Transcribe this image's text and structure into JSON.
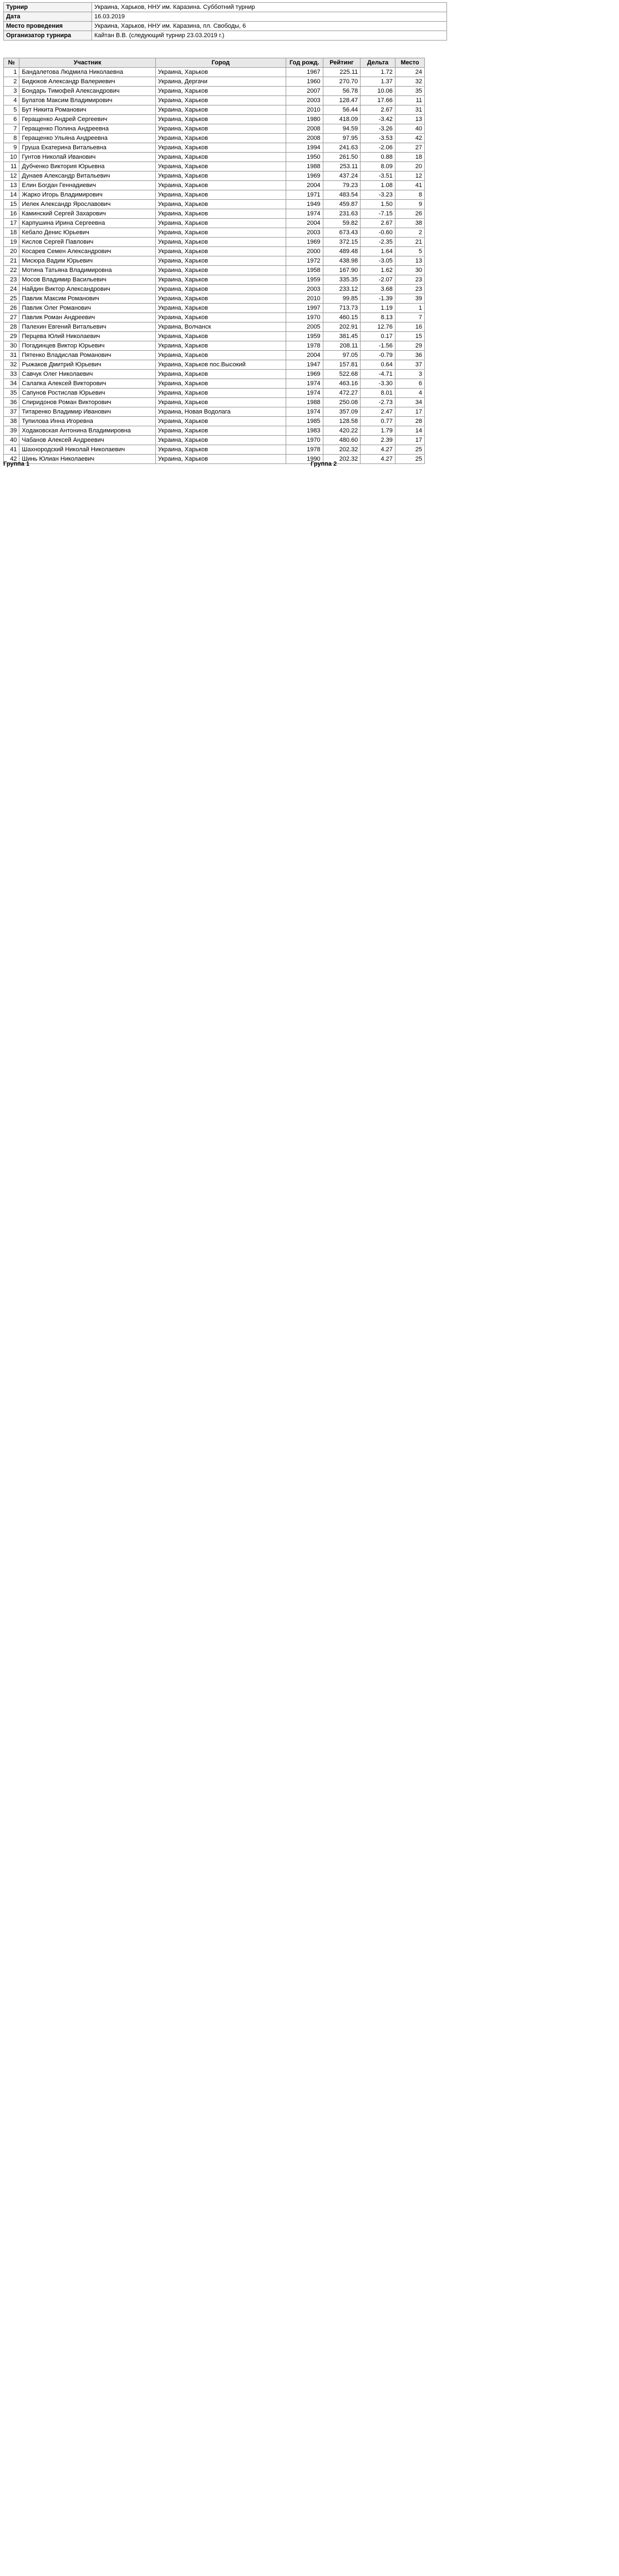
{
  "info": [
    {
      "label": "Турнир",
      "value": "Украина, Харьков, ННУ им. Каразина. Субботний турнир"
    },
    {
      "label": "Дата",
      "value": "16.03.2019"
    },
    {
      "label": "Место проведения",
      "value": "Украина, Харьков, ННУ им. Каразина, пл. Свободы, 6"
    },
    {
      "label": "Организатор турнира",
      "value": "Кайтан В.В. (следующий турнир 23.03.2019 г.)"
    }
  ],
  "players_header": {
    "n": "№",
    "name": "Участник",
    "city": "Город",
    "year": "Год рожд.",
    "rating": "Рейтинг",
    "delta": "Дельта",
    "place": "Место"
  },
  "players": [
    {
      "n": "1",
      "name": "Бандалетова Людмила Николаевна",
      "city": "Украина, Харьков",
      "year": "1967",
      "rating": "225.11",
      "delta": "1.72",
      "place": "24"
    },
    {
      "n": "2",
      "name": "Бидюков Александр Валериевич",
      "city": "Украина, Дергачи",
      "year": "1960",
      "rating": "270.70",
      "delta": "1.37",
      "place": "32"
    },
    {
      "n": "3",
      "name": "Бондарь Тимофей Александрович",
      "city": "Украина, Харьков",
      "year": "2007",
      "rating": "56.78",
      "delta": "10.06",
      "place": "35"
    },
    {
      "n": "4",
      "name": "Булатов Максим Владимирович",
      "city": "Украина, Харьков",
      "year": "2003",
      "rating": "128.47",
      "delta": "17.66",
      "place": "11"
    },
    {
      "n": "5",
      "name": "Бут Никита Романович",
      "city": "Украина, Харьков",
      "year": "2010",
      "rating": "56.44",
      "delta": "2.67",
      "place": "31"
    },
    {
      "n": "6",
      "name": "Геращенко Андрей Сергеевич",
      "city": "Украина, Харьков",
      "year": "1980",
      "rating": "418.09",
      "delta": "-3.42",
      "place": "13"
    },
    {
      "n": "7",
      "name": "Геращенко Полина Андреевна",
      "city": "Украина, Харьков",
      "year": "2008",
      "rating": "94.59",
      "delta": "-3.26",
      "place": "40"
    },
    {
      "n": "8",
      "name": "Геращенко Ульяна Андреевна",
      "city": "Украина, Харьков",
      "year": "2008",
      "rating": "97.95",
      "delta": "-3.53",
      "place": "42"
    },
    {
      "n": "9",
      "name": "Груша Екатерина Витальевна",
      "city": "Украина, Харьков",
      "year": "1994",
      "rating": "241.63",
      "delta": "-2.06",
      "place": "27"
    },
    {
      "n": "10",
      "name": "Гунтов Николай Иванович",
      "city": "Украина, Харьков",
      "year": "1950",
      "rating": "261.50",
      "delta": "0.88",
      "place": "18"
    },
    {
      "n": "11",
      "name": "Дубченко Виктория Юрьевна",
      "city": "Украина, Харьков",
      "year": "1988",
      "rating": "253.11",
      "delta": "8.09",
      "place": "20"
    },
    {
      "n": "12",
      "name": "Дунаев Александр Витальевич",
      "city": "Украина, Харьков",
      "year": "1969",
      "rating": "437.24",
      "delta": "-3.51",
      "place": "12"
    },
    {
      "n": "13",
      "name": "Елин Богдан Геннадиевич",
      "city": "Украина, Харьков",
      "year": "2004",
      "rating": "79.23",
      "delta": "1.08",
      "place": "41"
    },
    {
      "n": "14",
      "name": "Жарко Игорь Владимирович",
      "city": "Украина, Харьков",
      "year": "1971",
      "rating": "483.54",
      "delta": "-3.23",
      "place": "8"
    },
    {
      "n": "15",
      "name": "Иелек Александр Ярославович",
      "city": "Украина, Харьков",
      "year": "1949",
      "rating": "459.87",
      "delta": "1.50",
      "place": "9"
    },
    {
      "n": "16",
      "name": "Каминский Сергей Захарович",
      "city": "Украина, Харьков",
      "year": "1974",
      "rating": "231.63",
      "delta": "-7.15",
      "place": "26"
    },
    {
      "n": "17",
      "name": "Карпушина Ирина Сергеевна",
      "city": "Украина, Харьков",
      "year": "2004",
      "rating": "59.82",
      "delta": "2.67",
      "place": "38"
    },
    {
      "n": "18",
      "name": "Кебало Денис Юрьевич",
      "city": "Украина, Харьков",
      "year": "2003",
      "rating": "673.43",
      "delta": "-0.60",
      "place": "2"
    },
    {
      "n": "19",
      "name": "Кислов Сергей Павлович",
      "city": "Украина, Харьков",
      "year": "1969",
      "rating": "372.15",
      "delta": "-2.35",
      "place": "21"
    },
    {
      "n": "20",
      "name": "Косарев Семен Александрович",
      "city": "Украина, Харьков",
      "year": "2000",
      "rating": "489.48",
      "delta": "1.64",
      "place": "5"
    },
    {
      "n": "21",
      "name": "Мисюра Вадим Юрьевич",
      "city": "Украина, Харьков",
      "year": "1972",
      "rating": "438.98",
      "delta": "-3.05",
      "place": "13"
    },
    {
      "n": "22",
      "name": "Мотина Татьяна Владимировна",
      "city": "Украина, Харьков",
      "year": "1958",
      "rating": "167.90",
      "delta": "1.62",
      "place": "30"
    },
    {
      "n": "23",
      "name": "Мосов Владимир Васильевич",
      "city": "Украина, Харьков",
      "year": "1959",
      "rating": "335.35",
      "delta": "-2.07",
      "place": "23"
    },
    {
      "n": "24",
      "name": "Найдин Виктор Александрович",
      "city": "Украина, Харьков",
      "year": "2003",
      "rating": "233.12",
      "delta": "3.68",
      "place": "23"
    },
    {
      "n": "25",
      "name": "Павлик Максим Романович",
      "city": "Украина, Харьков",
      "year": "2010",
      "rating": "99.85",
      "delta": "-1.39",
      "place": "39"
    },
    {
      "n": "26",
      "name": "Павлик Олег Романович",
      "city": "Украина, Харьков",
      "year": "1997",
      "rating": "713.73",
      "delta": "1.19",
      "place": "1"
    },
    {
      "n": "27",
      "name": "Павлик Роман Андреевич",
      "city": "Украина, Харьков",
      "year": "1970",
      "rating": "460.15",
      "delta": "8.13",
      "place": "7"
    },
    {
      "n": "28",
      "name": "Палехин Евгений Витальевич",
      "city": "Украина, Волчанск",
      "year": "2005",
      "rating": "202.91",
      "delta": "12.76",
      "place": "16"
    },
    {
      "n": "29",
      "name": "Перцева Юлий Николаевич",
      "city": "Украина, Харьков",
      "year": "1959",
      "rating": "381.45",
      "delta": "0.17",
      "place": "15"
    },
    {
      "n": "30",
      "name": "Погадинцев Виктор Юрьевич",
      "city": "Украина, Харьков",
      "year": "1978",
      "rating": "208.11",
      "delta": "-1.56",
      "place": "29"
    },
    {
      "n": "31",
      "name": "Пятенко Владислав Романович",
      "city": "Украина, Харьков",
      "year": "2004",
      "rating": "97.05",
      "delta": "-0.79",
      "place": "36"
    },
    {
      "n": "32",
      "name": "Рыжаков Дмитрий Юрьевич",
      "city": "Украина, Харьков пос.Высокий",
      "year": "1947",
      "rating": "157.81",
      "delta": "0.64",
      "place": "37"
    },
    {
      "n": "33",
      "name": "Савчук Олег Николаевич",
      "city": "Украина, Харьков",
      "year": "1969",
      "rating": "522.68",
      "delta": "-4.71",
      "place": "3"
    },
    {
      "n": "34",
      "name": "Салапка Алексей Викторович",
      "city": "Украина, Харьков",
      "year": "1974",
      "rating": "463.16",
      "delta": "-3.30",
      "place": "6"
    },
    {
      "n": "35",
      "name": "Сапунов Ростислав Юрьевич",
      "city": "Украина, Харьков",
      "year": "1974",
      "rating": "472.27",
      "delta": "8.01",
      "place": "4"
    },
    {
      "n": "36",
      "name": "Спиридонов Роман Викторович",
      "city": "Украина, Харьков",
      "year": "1988",
      "rating": "250.08",
      "delta": "-2.73",
      "place": "34"
    },
    {
      "n": "37",
      "name": "Титаренко Владимир Иванович",
      "city": "Украина, Новая Водолага",
      "year": "1974",
      "rating": "357.09",
      "delta": "2.47",
      "place": "17"
    },
    {
      "n": "38",
      "name": "Тупилова Инна Игоревна",
      "city": "Украина, Харьков",
      "year": "1985",
      "rating": "128.58",
      "delta": "0.77",
      "place": "28"
    },
    {
      "n": "39",
      "name": "Ходаковская Антонина Владимировна",
      "city": "Украина, Харьков",
      "year": "1983",
      "rating": "420.22",
      "delta": "1.79",
      "place": "14"
    },
    {
      "n": "40",
      "name": "Чабанов Алексей Андреевич",
      "city": "Украина, Харьков",
      "year": "1970",
      "rating": "480.60",
      "delta": "2.39",
      "place": "17"
    },
    {
      "n": "41",
      "name": "Шахнородский Николай Николаевич",
      "city": "Украина, Харьков",
      "year": "1978",
      "rating": "202.32",
      "delta": "4.27",
      "place": "25"
    },
    {
      "n": "42",
      "name": "Шинь Юлиан Николаевич",
      "city": "Украина, Харьков",
      "year": "1990",
      "rating": "202.32",
      "delta": "4.27",
      "place": "25"
    }
  ],
  "group_titles": [
    "Группа 1",
    "Группа 2"
  ]
}
